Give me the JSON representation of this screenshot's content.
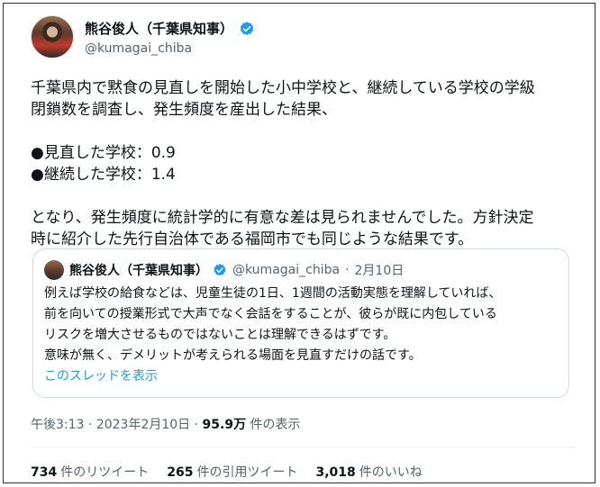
{
  "author": {
    "display_name": "熊谷俊人（千葉県知事）",
    "handle": "@kumagai_chiba"
  },
  "tweet": {
    "text": "千葉県内で黙食の見直しを開始した小中学校と、継続している学校の学級\n閉鎖数を調査し、発生頻度を産出した結果、\n\n●見直した学校：0.9\n●継続した学校：1.4\n\nとなり、発生頻度に統計学的に有意な差は見られませんでした。方針決定\n時に紹介した先行自治体である福岡市でも同じような結果です。"
  },
  "quoted_tweet": {
    "display_name": "熊谷俊人（千葉県知事）",
    "handle": "@kumagai_chiba",
    "separator": "·",
    "date": "2月10日",
    "text": "例えば学校の給食などは、児童生徒の1日、1週間の活動実態を理解していれば、\n前を向いての授業形式で大声でなく会話をすることが、彼らが既に内包している\nリスクを増大させるものではないことは理解できるはずです。\n意味が無く、デメリットが考えられる場面を見直すだけの話です。",
    "thread_link": "このスレッドを表示"
  },
  "meta": {
    "time": "午後3:13",
    "separator": "·",
    "date": "2023年2月10日",
    "separator2": "·",
    "views_count": "95.9万",
    "views_label": "件の表示"
  },
  "stats": {
    "retweets_count": "734",
    "retweets_label": "件のリツイート",
    "quotes_count": "265",
    "quotes_label": "件の引用ツイート",
    "likes_count": "3,018",
    "likes_label": "件のいいね"
  },
  "colors": {
    "verified": "#1d9bf0",
    "link": "#1d9bf0",
    "muted": "#536471"
  }
}
